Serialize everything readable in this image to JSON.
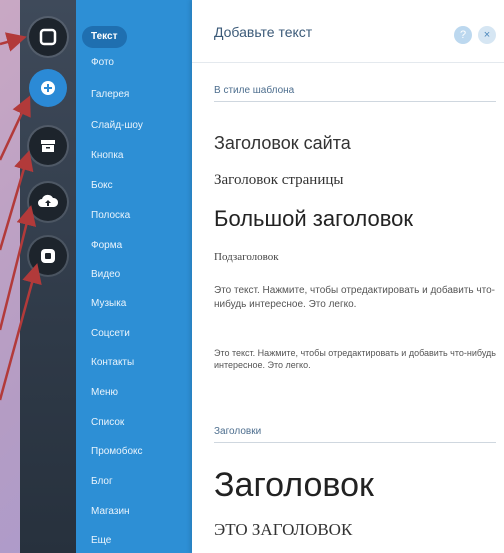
{
  "categories": [
    "Текст",
    "Фото",
    "Галерея",
    "Слайд-шоу",
    "Кнопка",
    "Бокс",
    "Полоска",
    "Форма",
    "Видео",
    "Музыка",
    "Соцсети",
    "Контакты",
    "Меню",
    "Список",
    "Промобокс",
    "Блог",
    "Магазин",
    "Еще"
  ],
  "active_category": "Текст",
  "panel": {
    "title": "Добавьте текст",
    "help_label": "?",
    "close_label": "×",
    "section_template": "В стиле шаблона",
    "site_title": "Заголовок сайта",
    "page_title": "Заголовок страницы",
    "big_title": "Большой заголовок",
    "subtitle": "Подзаголовок",
    "paragraph_1": "Это текст. Нажмите, чтобы отредактировать и добавить что-нибудь интересное. Это легко.",
    "paragraph_2": "Это текст. Нажмите, чтобы отредактировать и добавить что-нибудь интересное. Это легко.",
    "section_headings": "Заголовки",
    "heading_large": "Заголовок",
    "heading_caps": "ЭТО ЗАГОЛОВОК"
  },
  "colors": {
    "rail": "#2f3a48",
    "categories_bg": "#2d8fd5",
    "active_pill": "#1f6fb0",
    "arrow": "#b23a3a"
  },
  "rail_icons": [
    "square-icon",
    "plus-icon",
    "archive-icon",
    "cloud-upload-icon",
    "app-icon"
  ]
}
